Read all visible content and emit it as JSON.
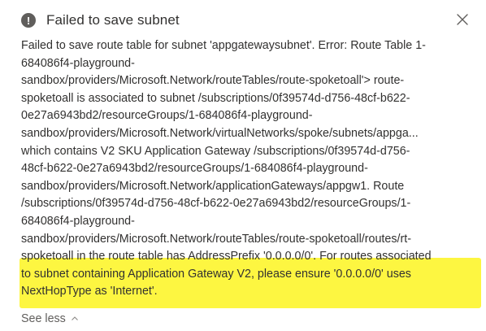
{
  "notification": {
    "title": "Failed to save subnet",
    "warning_icon": "!",
    "message_lines": [
      "Failed to save route table for subnet 'appgatewaysubnet'. Error: Route Table 1-",
      "684086f4-playground-",
      "sandbox/providers/Microsoft.Network/routeTables/route-spoketoall'> route-",
      "spoketoall is associated to subnet /subscriptions/0f39574d-d756-48cf-b622-",
      "0e27a6943bd2/resourceGroups/1-684086f4-playground-",
      "sandbox/providers/Microsoft.Network/virtualNetworks/spoke/subnets/appga...",
      "which contains V2 SKU Application Gateway /subscriptions/0f39574d-d756-",
      "48cf-b622-0e27a6943bd2/resourceGroups/1-684086f4-playground-",
      "sandbox/providers/Microsoft.Network/applicationGateways/appgw1. Route",
      "/subscriptions/0f39574d-d756-48cf-b622-0e27a6943bd2/resourceGroups/1-",
      "684086f4-playground-",
      "sandbox/providers/Microsoft.Network/routeTables/route-spoketoall/routes/rt-",
      "spoketoall in the route table has AddressPrefix '0.0.0.0/0'. For routes associated",
      "to subnet containing Application Gateway V2, please ensure '0.0.0.0/0' uses",
      "NextHopType as 'Internet'."
    ],
    "see_less_label": "See less"
  },
  "colors": {
    "highlight": "#fdf641",
    "text": "#323130",
    "icon": "#605e5c"
  },
  "icons": {
    "status": "warning-circle-icon",
    "close": "close-icon",
    "collapse": "chevron-up-icon"
  }
}
